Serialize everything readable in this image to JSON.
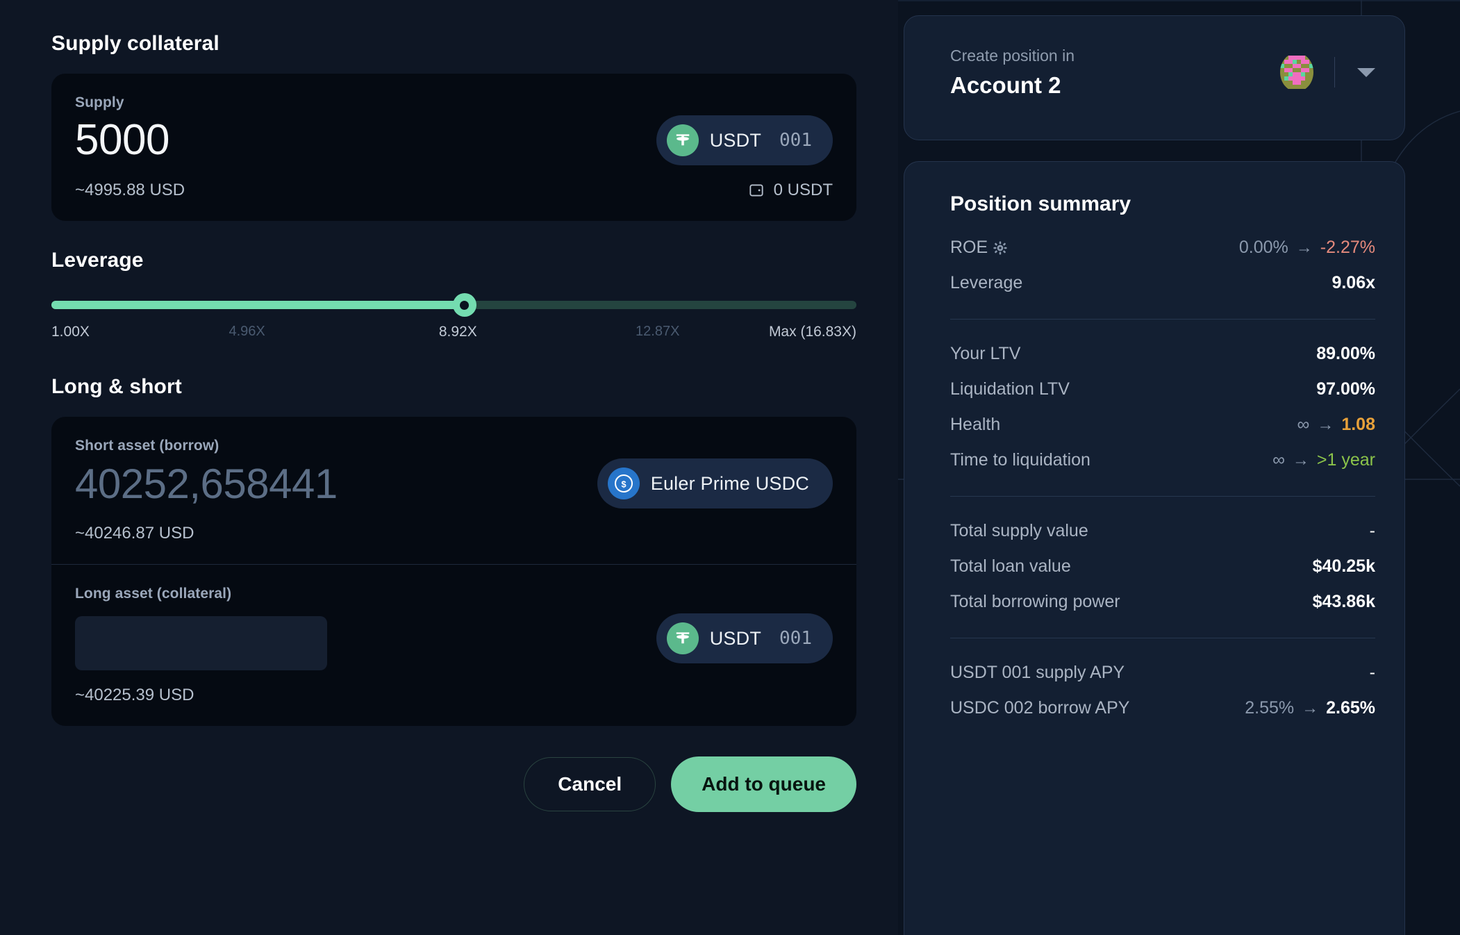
{
  "left": {
    "supply_section_title": "Supply collateral",
    "supply": {
      "label": "Supply",
      "value": "5000",
      "usd": "~4995.88 USD",
      "wallet_balance": "0 USDT",
      "token": {
        "symbol": "USDT",
        "suffix": "001",
        "icon": "tether-icon"
      }
    },
    "leverage_section_title": "Leverage",
    "leverage": {
      "ticks": [
        "1.00X",
        "4.96X",
        "8.92X",
        "12.87X",
        "Max (16.83X)"
      ],
      "current": "8.92X",
      "fill_percent": 51.3
    },
    "long_short_section_title": "Long & short",
    "short_asset": {
      "label": "Short asset (borrow)",
      "value": "40252,658441",
      "usd": "~40246.87 USD",
      "token": {
        "symbol": "Euler Prime USDC",
        "icon": "usdc-icon"
      }
    },
    "long_asset": {
      "label": "Long asset (collateral)",
      "value": "",
      "usd": "~40225.39 USD",
      "token": {
        "symbol": "USDT",
        "suffix": "001",
        "icon": "tether-icon"
      }
    },
    "buttons": {
      "cancel": "Cancel",
      "submit": "Add to queue"
    }
  },
  "right": {
    "account": {
      "label": "Create position in",
      "name": "Account 2",
      "avatar": "account-blockie",
      "caret": "chevron-down-icon"
    },
    "summary": {
      "title": "Position summary",
      "groups": [
        {
          "rows": [
            {
              "key": "ROE",
              "gear": true,
              "old": "0.00%",
              "arrow": "→",
              "new": "-2.27%",
              "tone": "neg"
            },
            {
              "key": "Leverage",
              "new": "9.06x",
              "tone": "plain"
            }
          ]
        },
        {
          "rows": [
            {
              "key": "Your LTV",
              "new": "89.00%",
              "tone": "plain"
            },
            {
              "key": "Liquidation LTV",
              "new": "97.00%",
              "tone": "plain"
            },
            {
              "key": "Health",
              "old": "∞",
              "arrow": "→",
              "new": "1.08",
              "tone": "warn"
            },
            {
              "key": "Time to liquidation",
              "old": "∞",
              "arrow": "→",
              "new": ">1 year",
              "tone": "good"
            }
          ]
        },
        {
          "rows": [
            {
              "key": "Total supply value",
              "new": "-",
              "tone": "dash"
            },
            {
              "key": "Total loan value",
              "new": "$40.25k",
              "tone": "plain"
            },
            {
              "key": "Total borrowing power",
              "new": "$43.86k",
              "tone": "plain"
            }
          ]
        },
        {
          "rows": [
            {
              "key": "USDT 001 supply APY",
              "new": "-",
              "tone": "dash"
            },
            {
              "key": "USDC 002 borrow APY",
              "old": "2.55%",
              "arrow": "→",
              "new": "2.65%",
              "tone": "plain"
            }
          ]
        }
      ]
    }
  },
  "colors": {
    "accent_green": "#74dcb0",
    "primary_button": "#74cfa4",
    "negative": "#e58a7c",
    "warning": "#e8a13a",
    "positive": "#8bc34a",
    "panel_bg": "#131f32",
    "left_bg": "#0e1624",
    "card_bg": "#050a12"
  }
}
